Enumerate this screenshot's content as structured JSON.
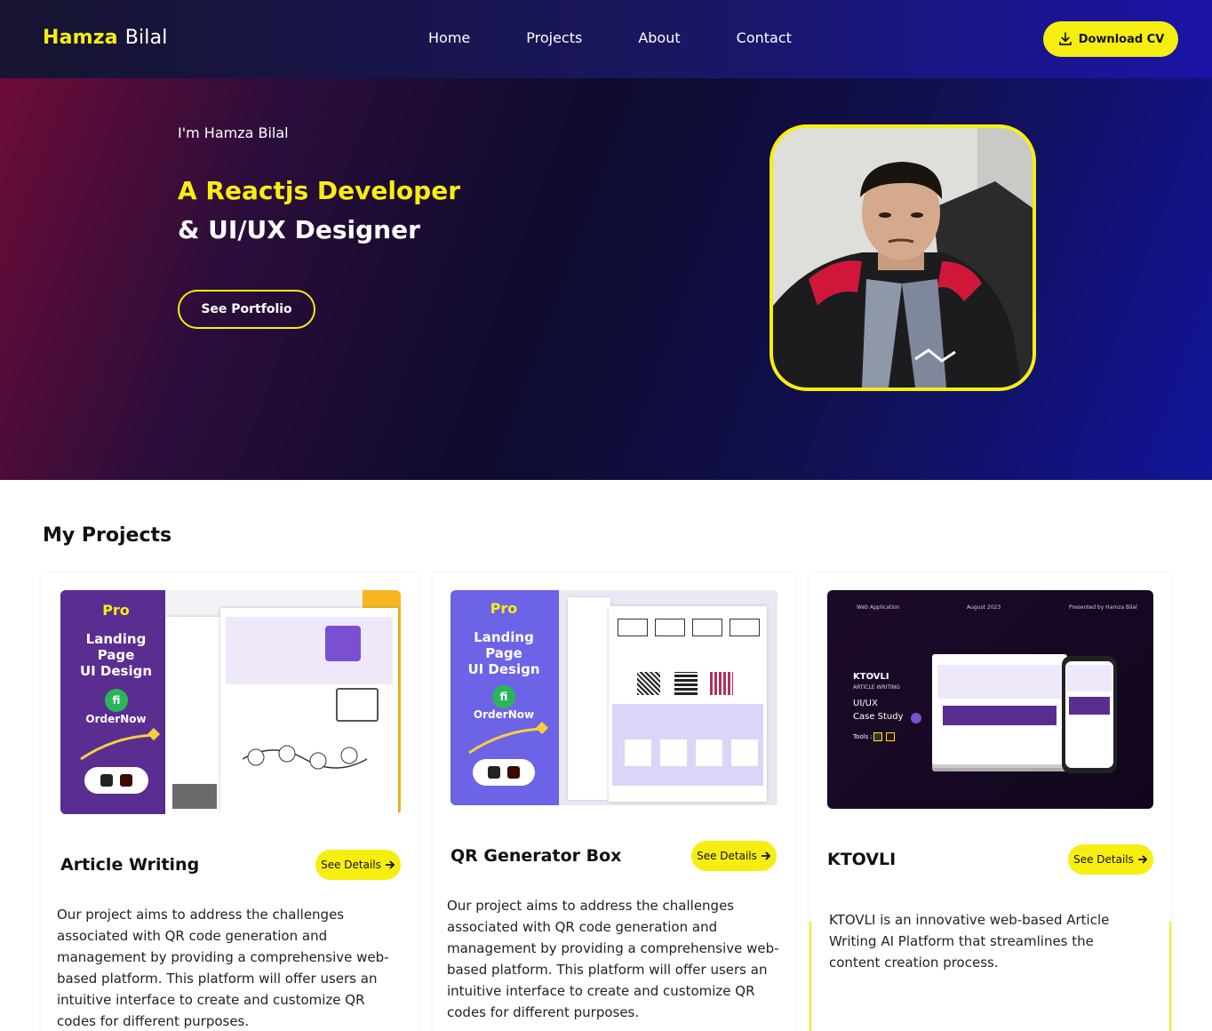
{
  "nav": {
    "logo_first": "Hamza",
    "logo_last": "Bilal",
    "links": [
      "Home",
      "Projects",
      "About",
      "Contact"
    ],
    "cta_label": "Download CV"
  },
  "hero": {
    "intro": "I'm Hamza Bilal",
    "headline_1": "A Reactjs Developer",
    "headline_2": "& UI/UX Designer",
    "button_label": "See Portfolio"
  },
  "projects": {
    "title": "My Projects",
    "details_label": "See Details",
    "items": [
      {
        "title": "Article Writing",
        "description": "Our project aims to address the challenges associated with QR code generation and management by providing a comprehensive web-based platform. This platform will offer users an intuitive interface to create and customize QR codes for different purposes.",
        "thumb": {
          "tag": "Pro",
          "lines": [
            "Landing",
            "Page",
            "UI Design"
          ],
          "brand": "OrderNow"
        }
      },
      {
        "title": "QR Generator Box",
        "description": "Our project aims to address the challenges associated with QR code generation and management by providing a comprehensive web-based platform. This platform will offer users an intuitive interface to create and customize QR codes for different purposes.",
        "thumb": {
          "tag": "Pro",
          "lines": [
            "Landing",
            "Page",
            "UI Design"
          ],
          "brand": "OrderNow"
        }
      },
      {
        "title": "KTOVLI",
        "description": "KTOVLI is an innovative web-based Article Writing AI Platform that streamlines the content creation process.",
        "thumb": {
          "brand": "KTOVLI",
          "sub": "ARTICLE WRITING",
          "line1": "UI/UX",
          "line2": "Case Study",
          "tools": "Tools :",
          "top_left": "Web Application",
          "top_mid": "August 2023",
          "top_right": "Presented by Hamza Bilal"
        }
      }
    ]
  },
  "colors": {
    "accent": "#f7ee11",
    "purple": "#5a2d91",
    "indigo": "#6c5ce7"
  },
  "icons": [
    "download-icon",
    "arrow-right-icon"
  ]
}
